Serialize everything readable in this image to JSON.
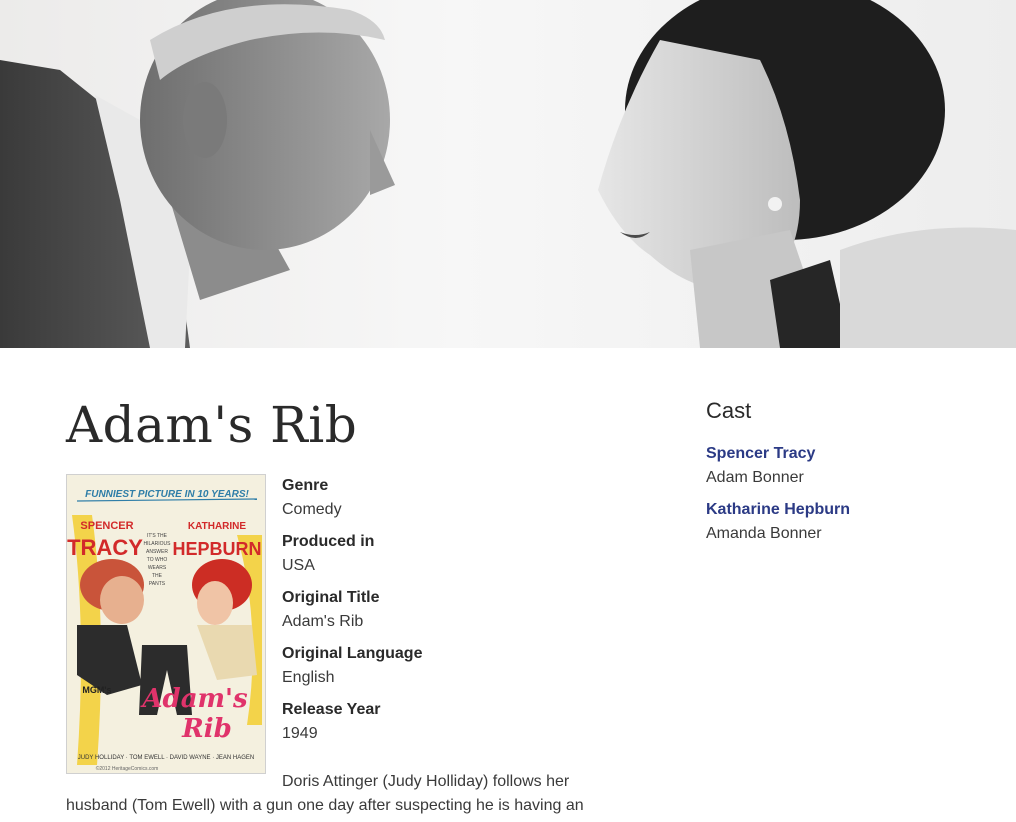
{
  "movie": {
    "title": "Adam's Rib",
    "synopsis": "Doris Attinger (Judy Holliday) follows her husband (Tom Ewell) with a gun one day after suspecting he is having an"
  },
  "hero": {
    "image": "spencer-tracy-katharine-hepburn-face-off-photo"
  },
  "poster": {
    "tagline": "FUNNIEST PICTURE IN 10 YEARS!",
    "star_left_first": "SPENCER",
    "star_left_last": "TRACY",
    "star_right_first": "KATHARINE",
    "star_right_last": "HEPBURN",
    "blurb": [
      "IT'S THE",
      "HILARIOUS",
      "ANSWER",
      "TO WHO",
      "WEARS",
      "THE",
      "PANTS"
    ],
    "studio": "MGM's",
    "title_line1": "Adam's",
    "title_line2": "Rib",
    "credits": "JUDY HOLLIDAY · TOM EWELL · DAVID WAYNE · JEAN HAGEN",
    "copyright": "©2012 HeritageComics.com"
  },
  "details": [
    {
      "label": "Genre",
      "value": "Comedy"
    },
    {
      "label": "Produced in",
      "value": "USA"
    },
    {
      "label": "Original Title",
      "value": "Adam's Rib"
    },
    {
      "label": "Original Language",
      "value": "English"
    },
    {
      "label": "Release Year",
      "value": "1949"
    }
  ],
  "cast": {
    "heading": "Cast",
    "members": [
      {
        "actor": "Spencer Tracy",
        "role": "Adam Bonner"
      },
      {
        "actor": "Katharine Hepburn",
        "role": "Amanda Bonner"
      }
    ]
  },
  "colors": {
    "link": "#2b3a85",
    "text": "#333333",
    "heading": "#2a2a2a"
  }
}
